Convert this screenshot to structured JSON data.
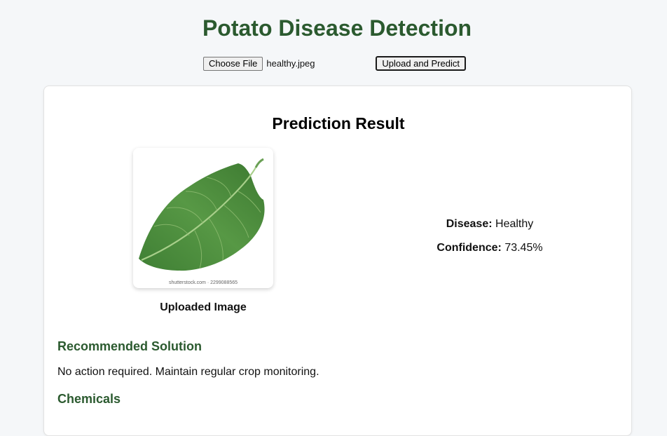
{
  "header": {
    "title": "Potato Disease Detection"
  },
  "upload": {
    "choose_file_label": "Choose File",
    "file_name": "healthy.jpeg",
    "submit_label": "Upload and Predict"
  },
  "result": {
    "title": "Prediction Result",
    "image_caption": "Uploaded Image",
    "image_watermark": "shutterstock.com · 2299088565",
    "disease_label": "Disease:",
    "disease_value": "Healthy",
    "confidence_label": "Confidence:",
    "confidence_value": "73.45%"
  },
  "solution": {
    "heading": "Recommended Solution",
    "text": "No action required. Maintain regular crop monitoring."
  },
  "chemicals": {
    "heading": "Chemicals"
  },
  "colors": {
    "accent_green": "#2b5a2f",
    "leaf_green": "#4a8a3c"
  }
}
